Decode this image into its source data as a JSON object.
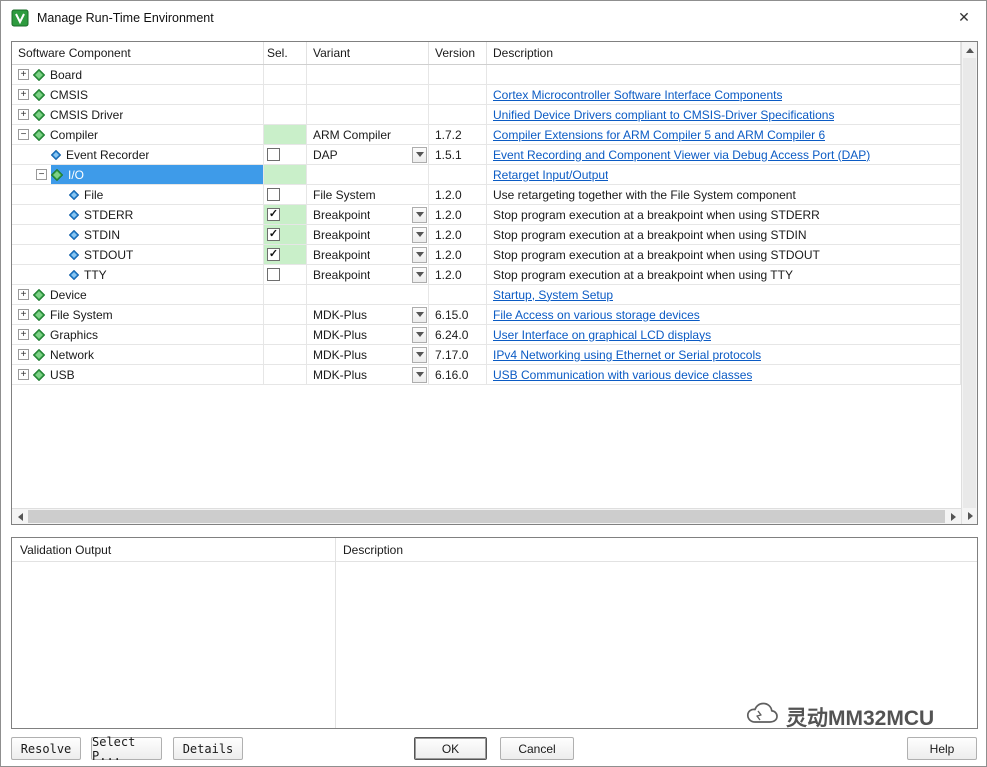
{
  "window": {
    "title": "Manage Run-Time Environment",
    "close_glyph": "✕"
  },
  "icons": {
    "plus": "+",
    "minus": "−",
    "check": "✓"
  },
  "colors": {
    "selection_blue": "#3e9be9",
    "row_green": "#c9efc9",
    "link_blue": "#0b5bc4"
  },
  "table": {
    "columns": [
      "Software Component",
      "Sel.",
      "Variant",
      "Version",
      "Description"
    ],
    "rows": [
      {
        "label": "Board",
        "level": 0,
        "expand": "plus",
        "icon": "green",
        "selected": false,
        "selGreen": false,
        "checkbox": "none",
        "variant": "",
        "dropdown": false,
        "version": "",
        "desc": "",
        "link": false
      },
      {
        "label": "CMSIS",
        "level": 0,
        "expand": "plus",
        "icon": "green",
        "selected": false,
        "selGreen": false,
        "checkbox": "none",
        "variant": "",
        "dropdown": false,
        "version": "",
        "desc": "Cortex Microcontroller Software Interface Components",
        "link": true
      },
      {
        "label": "CMSIS Driver",
        "level": 0,
        "expand": "plus",
        "icon": "green",
        "selected": false,
        "selGreen": false,
        "checkbox": "none",
        "variant": "",
        "dropdown": false,
        "version": "",
        "desc": "Unified Device Drivers compliant to CMSIS-Driver Specifications",
        "link": true
      },
      {
        "label": "Compiler",
        "level": 0,
        "expand": "minus",
        "icon": "green",
        "selected": false,
        "selGreen": true,
        "checkbox": "none",
        "variant": "ARM Compiler",
        "dropdown": false,
        "version": "1.7.2",
        "desc": "Compiler Extensions for ARM Compiler 5 and ARM Compiler 6",
        "link": true
      },
      {
        "label": "Event Recorder",
        "level": 1,
        "expand": "none",
        "icon": "blue",
        "selected": false,
        "selGreen": false,
        "checkbox": "unchecked",
        "variant": "DAP",
        "dropdown": true,
        "version": "1.5.1",
        "desc": "Event Recording and Component Viewer via Debug Access Port (DAP)",
        "link": true
      },
      {
        "label": "I/O",
        "level": 1,
        "expand": "minus",
        "icon": "green",
        "selected": true,
        "selGreen": true,
        "checkbox": "none",
        "variant": "",
        "dropdown": false,
        "version": "",
        "desc": "Retarget Input/Output",
        "link": true
      },
      {
        "label": "File",
        "level": 2,
        "expand": "none",
        "icon": "blue",
        "selected": false,
        "selGreen": false,
        "checkbox": "unchecked",
        "variant": "File System",
        "dropdown": false,
        "version": "1.2.0",
        "desc": "Use retargeting together with the File System component",
        "link": false
      },
      {
        "label": "STDERR",
        "level": 2,
        "expand": "none",
        "icon": "blue",
        "selected": false,
        "selGreen": true,
        "checkbox": "checked",
        "variant": "Breakpoint",
        "dropdown": true,
        "version": "1.2.0",
        "desc": "Stop program execution at a breakpoint when using STDERR",
        "link": false
      },
      {
        "label": "STDIN",
        "level": 2,
        "expand": "none",
        "icon": "blue",
        "selected": false,
        "selGreen": true,
        "checkbox": "checked",
        "variant": "Breakpoint",
        "dropdown": true,
        "version": "1.2.0",
        "desc": "Stop program execution at a breakpoint when using STDIN",
        "link": false
      },
      {
        "label": "STDOUT",
        "level": 2,
        "expand": "none",
        "icon": "blue",
        "selected": false,
        "selGreen": true,
        "checkbox": "checked",
        "variant": "Breakpoint",
        "dropdown": true,
        "version": "1.2.0",
        "desc": "Stop program execution at a breakpoint when using STDOUT",
        "link": false
      },
      {
        "label": "TTY",
        "level": 2,
        "expand": "none",
        "icon": "blue",
        "selected": false,
        "selGreen": false,
        "checkbox": "unchecked",
        "variant": "Breakpoint",
        "dropdown": true,
        "version": "1.2.0",
        "desc": "Stop program execution at a breakpoint when using TTY",
        "link": false
      },
      {
        "label": "Device",
        "level": 0,
        "expand": "plus",
        "icon": "green",
        "selected": false,
        "selGreen": false,
        "checkbox": "none",
        "variant": "",
        "dropdown": false,
        "version": "",
        "desc": "Startup, System Setup",
        "link": true
      },
      {
        "label": "File System",
        "level": 0,
        "expand": "plus",
        "icon": "green",
        "selected": false,
        "selGreen": false,
        "checkbox": "none",
        "variant": "MDK-Plus",
        "dropdown": true,
        "version": "6.15.0",
        "desc": "File Access on various storage devices",
        "link": true
      },
      {
        "label": "Graphics",
        "level": 0,
        "expand": "plus",
        "icon": "green",
        "selected": false,
        "selGreen": false,
        "checkbox": "none",
        "variant": "MDK-Plus",
        "dropdown": true,
        "version": "6.24.0",
        "desc": "User Interface on graphical LCD displays",
        "link": true
      },
      {
        "label": "Network",
        "level": 0,
        "expand": "plus",
        "icon": "green",
        "selected": false,
        "selGreen": false,
        "checkbox": "none",
        "variant": "MDK-Plus",
        "dropdown": true,
        "version": "7.17.0",
        "desc": "IPv4 Networking using Ethernet or Serial protocols",
        "link": true
      },
      {
        "label": "USB",
        "level": 0,
        "expand": "plus",
        "icon": "green",
        "selected": false,
        "selGreen": false,
        "checkbox": "none",
        "variant": "MDK-Plus",
        "dropdown": true,
        "version": "6.16.0",
        "desc": "USB Communication with various device classes",
        "link": true
      }
    ]
  },
  "bottom_panel": {
    "left_title": "Validation Output",
    "right_title": "Description"
  },
  "buttons": {
    "resolve": "Resolve",
    "select_packs": "Select P...",
    "details": "Details",
    "ok": "OK",
    "cancel": "Cancel",
    "help": "Help"
  },
  "watermark": {
    "text": "灵动MM32MCU"
  }
}
